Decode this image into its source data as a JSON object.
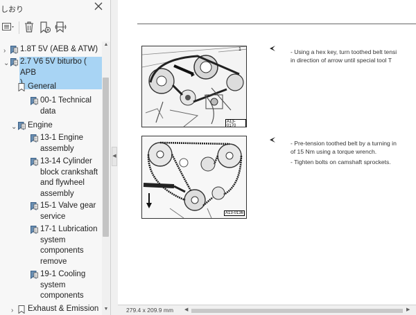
{
  "sidebar": {
    "title": "しおり",
    "tree": [
      {
        "label": "1.8T 5V (AEB & ATW)",
        "lines": [
          "1.8T 5V (AEB & ATW)"
        ]
      },
      {
        "label": "2.7 V6 5V biturbo ( APB )",
        "lines": [
          "2.7 V6 5V biturbo ( APB",
          ")"
        ],
        "selected": true
      },
      {
        "label": "General",
        "lines": [
          "General"
        ]
      },
      {
        "label": "00-1 Technical data",
        "lines": [
          "00-1 Technical",
          "data"
        ]
      },
      {
        "label": "Engine",
        "lines": [
          "Engine"
        ]
      },
      {
        "label": "13-1 Engine assembly",
        "lines": [
          "13-1 Engine",
          "assembly"
        ]
      },
      {
        "label": "13-14 Cylinder block crankshaft and flywheel assembly",
        "lines": [
          "13-14 Cylinder",
          "block crankshaft",
          "and flywheel",
          "assembly"
        ]
      },
      {
        "label": "15-1 Valve gear service",
        "lines": [
          "15-1 Valve gear",
          "service"
        ]
      },
      {
        "label": "17-1 Lubrication system components remove",
        "lines": [
          "17-1 Lubrication",
          "system",
          "components",
          "remove"
        ]
      },
      {
        "label": "19-1 Cooling system components",
        "lines": [
          "19-1 Cooling",
          "system",
          "components"
        ]
      },
      {
        "label": "Exhaust & Emission",
        "lines": [
          "Exhaust & Emission"
        ]
      }
    ]
  },
  "document": {
    "figure1": {
      "tag": "A13-0170",
      "callout": "1"
    },
    "figure2": {
      "tag": "A13-0136"
    },
    "step1": {
      "lines": [
        "-  Using a hex key, turn toothed belt tensi",
        "   in direction of arrow until special tool T"
      ]
    },
    "step2": {
      "lines": [
        "-  Pre-tension toothed belt by a turning in",
        "   of 15 Nm using a torque wrench."
      ]
    },
    "step3": {
      "lines": [
        "-  Tighten bolts on camshaft sprockets."
      ]
    }
  },
  "statusbar": {
    "page_size": "279.4 x 209.9 mm"
  },
  "icons": {
    "options": "options-list-icon",
    "delete": "trash-icon",
    "new_bookmark": "new-bookmark-icon",
    "find_bookmark": "find-bookmark-icon",
    "bookmark": "bookmark-icon",
    "page_bookmark": "page-bookmark-icon",
    "close": "close-icon"
  },
  "colors": {
    "selection": "#a8d4f4",
    "panel": "#f7f7f7",
    "page": "#ffffff",
    "scroll_thumb": "#c4c4c4"
  }
}
